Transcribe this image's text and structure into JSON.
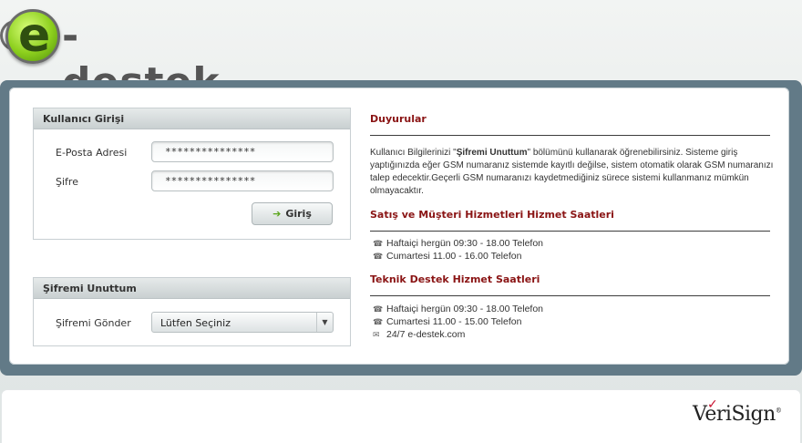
{
  "logo": {
    "letter": "e",
    "text": "-destek"
  },
  "login": {
    "title": "Kullanıcı Girişi",
    "email_label": "E-Posta Adresi",
    "email_value": "***************",
    "password_label": "Şifre",
    "password_value": "***************",
    "submit_label": "Giriş"
  },
  "forgot": {
    "title": "Şifremi Unuttum",
    "send_label": "Şifremi Gönder",
    "select_value": "Lütfen Seçiniz"
  },
  "announcements": {
    "title": "Duyurular",
    "text_before": "Kullanıcı Bilgilerinizi \"",
    "text_bold": "Şifremi Unuttum",
    "text_after": "\" bölümünü kullanarak öğrenebilirsiniz. Sisteme giriş yaptığınızda eğer GSM numaranız sistemde kayıtlı değilse, sistem otomatik olarak GSM numaranızı talep edecektir.Geçerli GSM numaranızı kaydetmediğiniz sürece sistemi kullanmanız mümkün olmayacaktır."
  },
  "sales_hours": {
    "title": "Satış ve Müşteri Hizmetleri Hizmet Saatleri",
    "lines": [
      "Haftaiçi hergün 09:30 - 18.00 Telefon",
      "Cumartesi 11.00 - 16.00 Telefon"
    ]
  },
  "tech_hours": {
    "title": "Teknik Destek Hizmet Saatleri",
    "lines": [
      "Haftaiçi hergün 09:30 - 18.00 Telefon",
      "Cumartesi 11.00 - 15.00 Telefon",
      "24/7 e-destek.com"
    ]
  },
  "footer": {
    "brand": "VeriSign"
  },
  "icons": {
    "phone": "phone-icon",
    "mail": "mail-icon",
    "arrow": "arrow-right-icon",
    "caret": "chevron-down-icon"
  },
  "colors": {
    "accent_red": "#8a1414",
    "frame": "#627a87",
    "green_arrow": "#5aa51a"
  }
}
